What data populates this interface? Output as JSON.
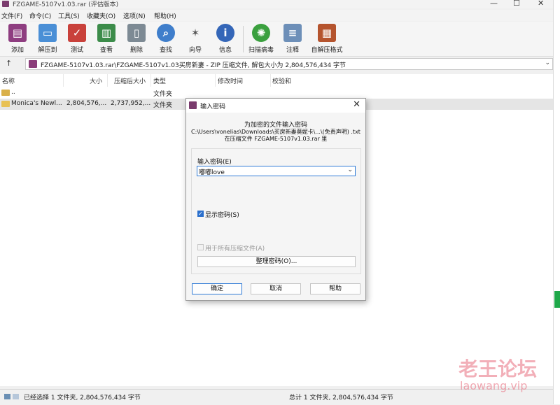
{
  "window": {
    "title": "FZGAME-5107v1.03.rar (评估版本)",
    "controls": [
      "—",
      "☐",
      "✕"
    ]
  },
  "menu": [
    "文件(F)",
    "命令(C)",
    "工具(S)",
    "收藏夹(O)",
    "选项(N)",
    "帮助(H)"
  ],
  "toolbar": [
    {
      "label": "添加",
      "icon": "add-archive-icon"
    },
    {
      "label": "解压到",
      "icon": "extract-to-icon"
    },
    {
      "label": "测试",
      "icon": "test-icon"
    },
    {
      "label": "查看",
      "icon": "view-icon"
    },
    {
      "label": "删除",
      "icon": "delete-icon"
    },
    {
      "label": "查找",
      "icon": "find-icon"
    },
    {
      "label": "向导",
      "icon": "wizard-icon"
    },
    {
      "label": "信息",
      "icon": "info-icon"
    },
    {
      "label": "扫描病毒",
      "icon": "virus-scan-icon"
    },
    {
      "label": "注释",
      "icon": "comment-icon"
    },
    {
      "label": "自解压格式",
      "icon": "sfx-icon"
    }
  ],
  "address": {
    "up": "↑",
    "text": "FZGAME-5107v1.03.rar\\FZGAME-5107v1.03买房新妻 - ZIP 压缩文件, 解包大小为 2,804,576,434 字节",
    "dropdown": "⌄"
  },
  "columns": [
    "名称",
    "大小",
    "压缩后大小",
    "类型",
    "修改时间",
    "校验和"
  ],
  "rows": [
    {
      "name": "..",
      "size": "",
      "packed": "",
      "type": "文件夹",
      "modified": "",
      "crc": ""
    },
    {
      "name": "Monica's Newl...",
      "size": "2,804,576,...",
      "packed": "2,737,952,...",
      "type": "文件夹",
      "modified": "",
      "crc": ""
    }
  ],
  "status": {
    "left": "已经选择 1 文件夹, 2,804,576,434 字节",
    "right": "总计 1 文件夹, 2,804,576,434 字节"
  },
  "dialog": {
    "title": "输入密码",
    "close": "✕",
    "message_line1": "为加密的文件输入密码",
    "message_line2": "C:\\Users\\vonelias\\Downloads\\买房新妻莫妮卡\\...\\(免责声明) .txt",
    "message_line3": "在压缩文件 FZGAME-5107v1.03.rar 里",
    "password_label": "输入密码(E)",
    "password_value": "嘟嘟love",
    "show_password_label": "显示密码(S)",
    "show_password_checked": true,
    "use_for_all_label": "用于所有压缩文件(A)",
    "use_for_all_checked": false,
    "organize_button": "整理密码(O)...",
    "ok_button": "确定",
    "cancel_button": "取消",
    "help_button": "帮助"
  },
  "watermark": {
    "line1": "老王论坛",
    "line2": "laowang.vip"
  },
  "colors": {
    "accent": "#2f7bd6",
    "winrar": "#7a3b6d",
    "watermark": "#e86f7f"
  }
}
